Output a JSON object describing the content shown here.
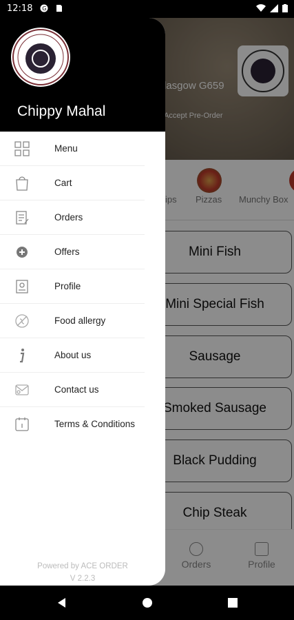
{
  "status_bar": {
    "time": "12:18",
    "icons": [
      "google-icon",
      "sim-icon",
      "wifi-icon",
      "signal-icon",
      "battery-icon"
    ]
  },
  "background": {
    "address": "lasgow G659",
    "preorder": "Accept Pre-Order",
    "categories": [
      {
        "label": "ips",
        "icon": "fries-icon"
      },
      {
        "label": "Pizzas",
        "icon": "pizza-icon"
      },
      {
        "label": "Munchy Box",
        "icon": "box-icon"
      }
    ],
    "items": [
      "Mini Fish",
      "Mini Special Fish",
      "Sausage",
      "Smoked Sausage",
      "Black Pudding",
      "Chip Steak"
    ],
    "tabs": [
      {
        "label": "Orders",
        "icon": "orders-icon"
      },
      {
        "label": "Profile",
        "icon": "profile-icon"
      }
    ]
  },
  "drawer": {
    "logo_text": "THE NEW CHIPPY MAHAL",
    "title": "Chippy Mahal",
    "menu": [
      {
        "label": "Menu",
        "icon": "grid-icon"
      },
      {
        "label": "Cart",
        "icon": "cart-icon"
      },
      {
        "label": "Orders",
        "icon": "orders-icon"
      },
      {
        "label": "Offers",
        "icon": "offers-icon"
      },
      {
        "label": "Profile",
        "icon": "profile-icon"
      },
      {
        "label": "Food allergy",
        "icon": "allergy-icon"
      },
      {
        "label": "About us",
        "icon": "info-icon"
      },
      {
        "label": "Contact us",
        "icon": "contact-icon"
      },
      {
        "label": "Terms & Conditions",
        "icon": "calendar-icon"
      }
    ],
    "powered_by": "Powered by ACE ORDER",
    "version": "V 2.2.3"
  },
  "colors": {
    "drawer_header": "#000000",
    "accent": "#000000"
  }
}
